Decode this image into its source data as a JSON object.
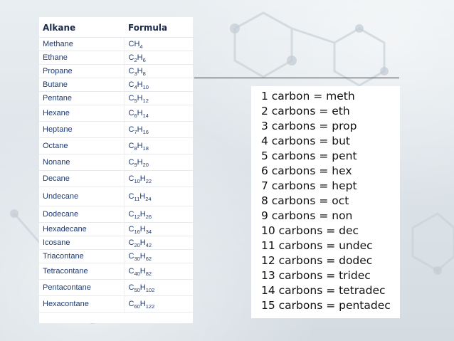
{
  "table": {
    "headers": [
      "Alkane",
      "Formula"
    ],
    "rows": [
      {
        "name": "Methane",
        "formula": [
          [
            "C",
            ""
          ],
          [
            "H",
            "4"
          ]
        ]
      },
      {
        "name": "Ethane",
        "formula": [
          [
            "C",
            "2"
          ],
          [
            "H",
            "6"
          ]
        ]
      },
      {
        "name": "Propane",
        "formula": [
          [
            "C",
            "3"
          ],
          [
            "H",
            "8"
          ]
        ]
      },
      {
        "name": "Butane",
        "formula": [
          [
            "C",
            "4"
          ],
          [
            "H",
            "10"
          ]
        ]
      },
      {
        "name": "Pentane",
        "formula": [
          [
            "C",
            "5"
          ],
          [
            "H",
            "12"
          ]
        ]
      },
      {
        "name": "Hexane",
        "formula": [
          [
            "C",
            "6"
          ],
          [
            "H",
            "14"
          ]
        ]
      },
      {
        "name": "Heptane",
        "formula": [
          [
            "C",
            "7"
          ],
          [
            "H",
            "16"
          ]
        ]
      },
      {
        "name": "Octane",
        "formula": [
          [
            "C",
            "8"
          ],
          [
            "H",
            "18"
          ]
        ]
      },
      {
        "name": "Nonane",
        "formula": [
          [
            "C",
            "9"
          ],
          [
            "H",
            "20"
          ]
        ]
      },
      {
        "name": "Decane",
        "formula": [
          [
            "C",
            "10"
          ],
          [
            "H",
            "22"
          ]
        ]
      },
      {
        "name": "Undecane",
        "formula": [
          [
            "C",
            "11"
          ],
          [
            "H",
            "24"
          ]
        ]
      },
      {
        "name": "Dodecane",
        "formula": [
          [
            "C",
            "12"
          ],
          [
            "H",
            "26"
          ]
        ]
      },
      {
        "name": "Hexadecane",
        "formula": [
          [
            "C",
            "16"
          ],
          [
            "H",
            "34"
          ]
        ]
      },
      {
        "name": "Icosane",
        "formula": [
          [
            "C",
            "20"
          ],
          [
            "H",
            "42"
          ]
        ]
      },
      {
        "name": "Triacontane",
        "formula": [
          [
            "C",
            "30"
          ],
          [
            "H",
            "62"
          ]
        ]
      },
      {
        "name": "Tetracontane",
        "formula": [
          [
            "C",
            "40"
          ],
          [
            "H",
            "82"
          ]
        ]
      },
      {
        "name": "Pentacontane",
        "formula": [
          [
            "C",
            "50"
          ],
          [
            "H",
            "102"
          ]
        ]
      },
      {
        "name": "Hexacontane",
        "formula": [
          [
            "C",
            "60"
          ],
          [
            "H",
            "122"
          ]
        ]
      }
    ]
  },
  "prefixes": [
    "1 carbon = meth",
    "2 carbons = eth",
    "3 carbons = prop",
    "4 carbons = but",
    "5 carbons = pent",
    "6 carbons = hex",
    "7 carbons = hept",
    "8 carbons = oct",
    "9 carbons = non",
    "10 carbons = dec",
    "11 carbons = undec",
    "12 carbons = dodec",
    "13 carbons = tridec",
    "14 carbons = tetradec",
    "15 carbons = pentadec"
  ],
  "colors": {
    "header_text": "#1b2a4a",
    "cell_text": "#1d3a73",
    "prefix_text": "#111111"
  }
}
